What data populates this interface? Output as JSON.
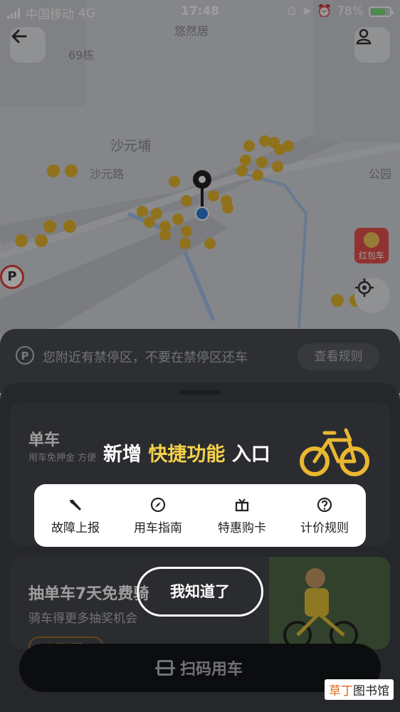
{
  "status_bar": {
    "carrier": "中国移动",
    "network": "4G",
    "time": "17:48",
    "battery": "78%",
    "battery_level": 0.78
  },
  "map": {
    "labels": [
      "悠然居",
      "69栋",
      "沙元埔",
      "沙元路",
      "公园"
    ],
    "redpack_label": "红包车"
  },
  "notice": {
    "text": "您附近有禁停区，不要在禁停区还车",
    "button": "查看规则"
  },
  "card1": {
    "title": "单车",
    "subtitle": "用车免押金  方便"
  },
  "card2": {
    "title": "抽单车7天免费骑",
    "subtitle": "骑车得更多抽奖机会",
    "pill": "立即领取"
  },
  "scan_button": "扫码用车",
  "overlay": {
    "title_prefix": "新增",
    "title_highlight": "快捷功能",
    "title_suffix": "入口",
    "shortcuts": [
      {
        "label": "故障上报",
        "icon": "wrench-icon"
      },
      {
        "label": "用车指南",
        "icon": "compass-icon"
      },
      {
        "label": "特惠购卡",
        "icon": "gift-icon"
      },
      {
        "label": "计价规则",
        "icon": "question-icon"
      }
    ],
    "got_it": "我知道了"
  },
  "watermark": {
    "red": "草丁",
    "rest": "图书馆"
  },
  "colors": {
    "highlight": "#f5d24a",
    "bike_yellow": "#e9b830",
    "red": "#e8534e"
  }
}
